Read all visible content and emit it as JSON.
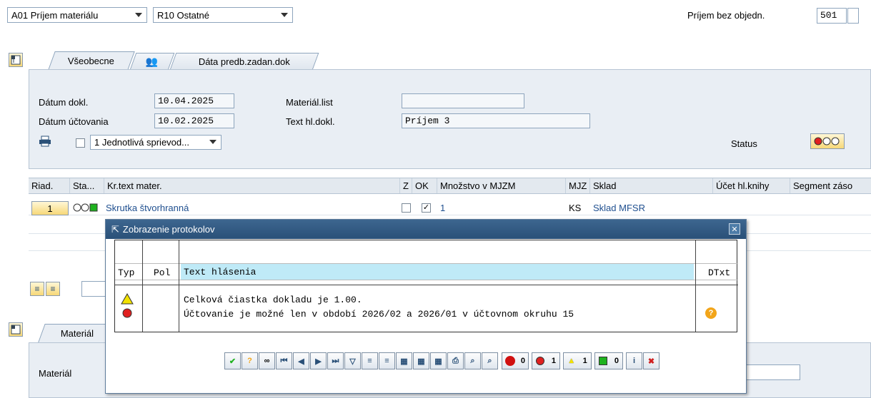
{
  "top": {
    "transaction_select": "A01 Príjem materiálu",
    "reference_select": "R10 Ostatné",
    "movement_label": "Príjem bez objedn.",
    "movement_value": "501"
  },
  "tabs": [
    {
      "label": "Všeobecne"
    },
    {
      "label": ""
    },
    {
      "label": "Dáta predb.zadan.dok"
    }
  ],
  "header": {
    "doc_date_label": "Dátum dokl.",
    "doc_date_value": "10.04.2025",
    "posting_date_label": "Dátum účtovania",
    "posting_date_value": "10.02.2025",
    "material_slip_label": "Materiál.list",
    "material_slip_value": "",
    "header_text_label": "Text hl.dokl.",
    "header_text_value": "Príjem 3",
    "print_select": "1 Jednotlivá sprievod...",
    "status_label": "Status"
  },
  "items_table": {
    "columns": [
      "Riad.",
      "Sta...",
      "Kr.text mater.",
      "Z",
      "OK",
      "Množstvo v MJZM",
      "MJZ",
      "Sklad",
      "Účet hl.knihy",
      "Segment záso"
    ],
    "rows": [
      {
        "line": "1",
        "text": "Skrutka štvorhranná",
        "qty": "1",
        "unit": "KS",
        "storage": "Sklad MFSR",
        "ok_checked": true,
        "z_checked": false
      }
    ]
  },
  "material_tab": {
    "tab_label": "Materiál",
    "field_label": "Materiál"
  },
  "dialog": {
    "title": "Zobrazenie protokolov",
    "columns": {
      "type": "Typ",
      "pos": "Pol",
      "text": "Text hlásenia",
      "dtext": "DTxt"
    },
    "messages": [
      {
        "severity": "warning",
        "text": "Celková čiastka dokladu je 1.00."
      },
      {
        "severity": "error",
        "text": "Účtovanie je možné len v období 2026/02 a 2026/01 v účtovnom okruhu 15"
      }
    ],
    "counters": {
      "stop": "0",
      "error": "1",
      "warning": "1",
      "success": "0"
    }
  },
  "colors": {
    "accent": "#2a5078",
    "panel": "#e9eef4",
    "header_bg": "#bfeaf7",
    "error": "#e02020",
    "warning": "#f2e200",
    "success": "#1fb21f"
  }
}
